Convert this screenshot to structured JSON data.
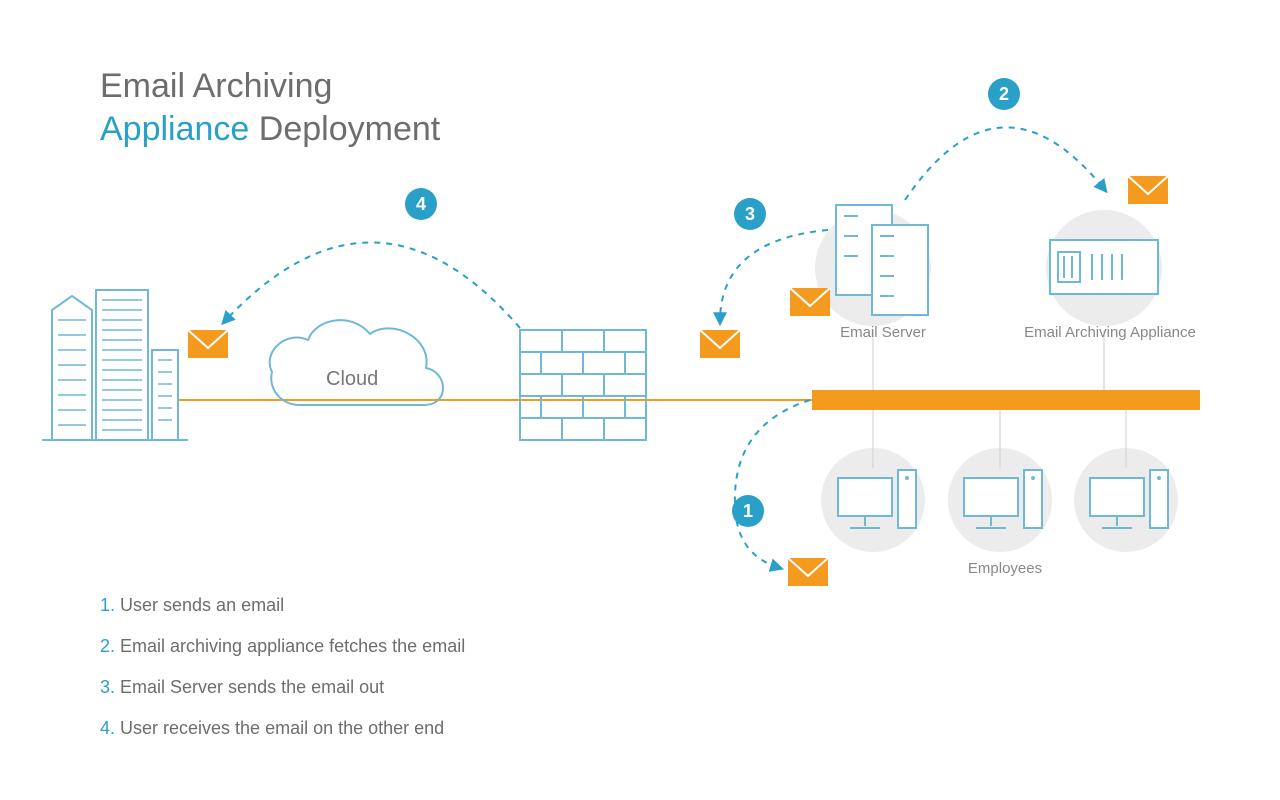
{
  "title": {
    "line1": "Email Archiving",
    "line2a": "Appliance",
    "line2b": " Deployment"
  },
  "cloud_label": "Cloud",
  "labels": {
    "email_server": "Email Server",
    "appliance": "Email Archiving Appliance",
    "employees": "Employees"
  },
  "steps": {
    "s1": "1",
    "s2": "2",
    "s3": "3",
    "s4": "4"
  },
  "legend": [
    {
      "num": "1.",
      "text": " User sends an email"
    },
    {
      "num": "2.",
      "text": " Email archiving appliance fetches the email"
    },
    {
      "num": "3.",
      "text": " Email Server sends the email out"
    },
    {
      "num": "4.",
      "text": " User receives the email on the other end"
    }
  ],
  "colors": {
    "blue": "#2aa0c9",
    "blue_line": "#6fb9d6",
    "orange": "#f49a1e",
    "grey_light": "#e9e9e9",
    "grey_text": "#6d6d6d"
  }
}
